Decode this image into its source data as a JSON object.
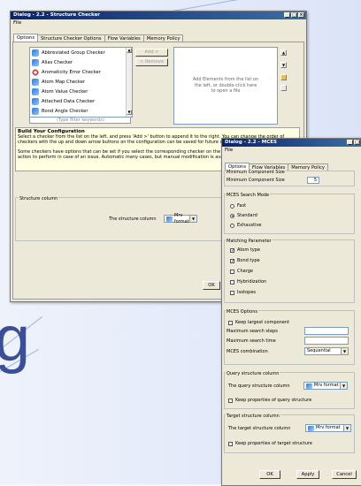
{
  "structure_checker": {
    "title": "Dialog - 2.2 - Structure Checker",
    "menu_file": "File",
    "tabs": [
      "Options",
      "Structure Checker Options",
      "Flow Variables",
      "Memory Policy"
    ],
    "checkers": [
      "Abbreviated Group Checker",
      "Alias Checker",
      "Aromaticity Error Checker",
      "Atom Map Checker",
      "Atom Value Checker",
      "Attached Data Checker",
      "Bond Angle Checker"
    ],
    "filter_placeholder": "(Type filter keywords)",
    "add_button": "Add >",
    "remove_button": "< Remove",
    "right_hint": "Add Elements from the list on the left, or double-click here to open a file",
    "config_title": "Build Your Configuration",
    "config_text_1": "Select a checker from the list on the left, and press 'Add >' button to append it to the right. You can change the order of checkers with the up and down arrow buttons on the configuration can be saved for future use.",
    "config_text_2": "Some checkers have options that can be set if you select the corresponding checker on the right. You can also select what action to perform in case of an issue. Automatic many cases, but manual modification is available as an option as well.",
    "structure_column_group": "Structure column",
    "structure_column_label": "The structure column",
    "structure_column_value": "Mrv format",
    "ok_button": "OK"
  },
  "mces": {
    "title": "Dialog - 2.2 - MCES",
    "menu_file": "File",
    "tabs": [
      "Options",
      "Flow Variables",
      "Memory Policy"
    ],
    "min_size_group": "Minimum Component Size",
    "min_size_label": "Minimum Component Size",
    "min_size_value": "5",
    "search_mode_group": "MCES Search Mode",
    "search_modes": [
      {
        "label": "Fast",
        "selected": false
      },
      {
        "label": "Standard",
        "selected": true
      },
      {
        "label": "Exhaustive",
        "selected": false
      }
    ],
    "matching_group": "Matching Parameter",
    "matching_params": [
      {
        "label": "Atom type",
        "checked": true
      },
      {
        "label": "Bond type",
        "checked": true
      },
      {
        "label": "Charge",
        "checked": false
      },
      {
        "label": "Hybridization",
        "checked": false
      },
      {
        "label": "Isotopes",
        "checked": false
      }
    ],
    "options_group": "MCES Options",
    "keep_largest": "Keep largest component",
    "max_steps_label": "Maximum search steps",
    "max_time_label": "Maximum search time",
    "combination_label": "MCES combination",
    "combination_value": "Sequential",
    "query_group": "Query structure column",
    "query_label": "The query structure column",
    "query_value": "Mrv format",
    "query_keep": "Keep properties of query structure",
    "target_group": "Target structure column",
    "target_label": "The target structure column",
    "target_value": "Mrv format",
    "target_keep": "Keep properties of target structure",
    "ok_button": "OK",
    "apply_button": "Apply",
    "cancel_button": "Cancel"
  },
  "slide_text": "g"
}
